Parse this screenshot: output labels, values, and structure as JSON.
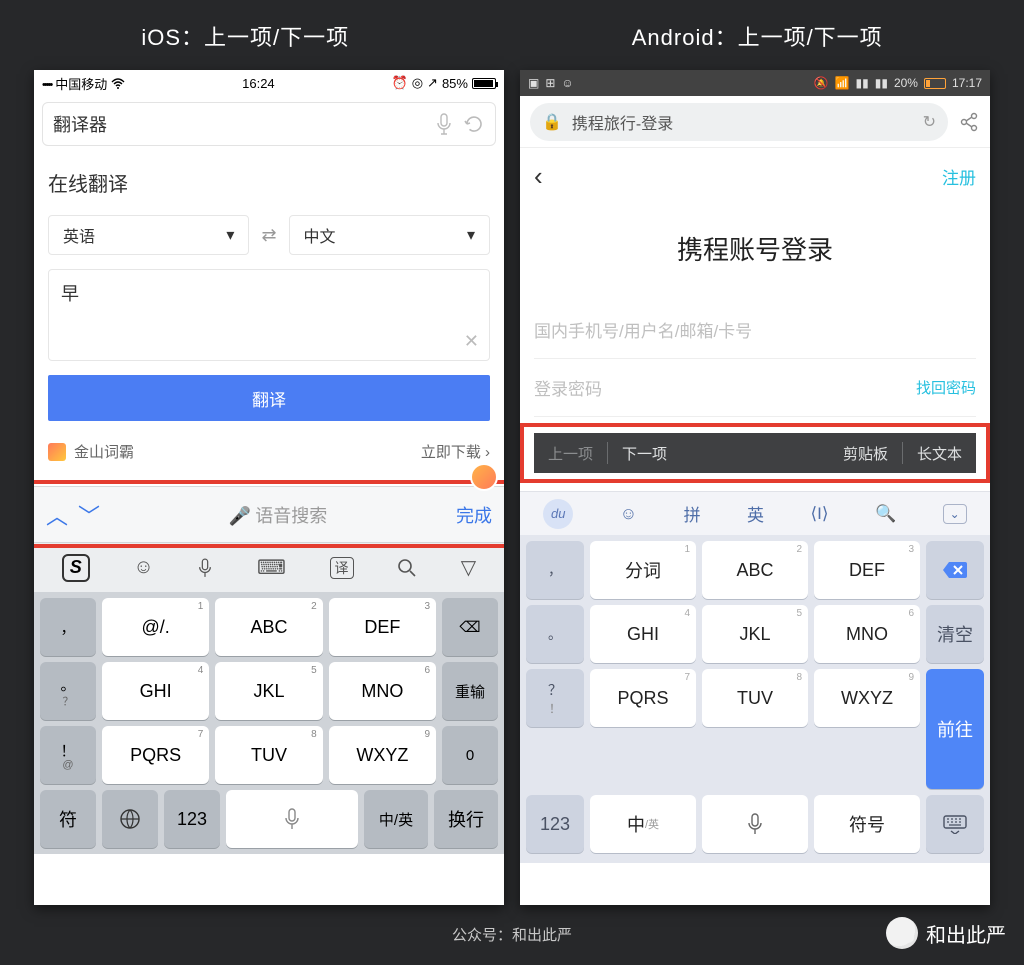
{
  "titles": {
    "ios": "iOS：上一项/下一项",
    "android": "Android：上一项/下一项"
  },
  "ios": {
    "status": {
      "carrier": "中国移动",
      "time": "16:24",
      "battery": "85%"
    },
    "search": {
      "value": "翻译器"
    },
    "card": {
      "title": "在线翻译",
      "source": "英语",
      "target": "中文",
      "text": "早",
      "button": "翻译",
      "dict": "金山词霸",
      "download": "立即下载"
    },
    "accessory": {
      "voice": "语音搜索",
      "done": "完成"
    },
    "cand_logo": "S",
    "kb": {
      "r1": [
        "@/.",
        "ABC",
        "DEF"
      ],
      "r2": [
        "GHI",
        "JKL",
        "MNO"
      ],
      "r3": [
        "PQRS",
        "TUV",
        "WXYZ"
      ],
      "left": [
        "，",
        "。",
        "？",
        "！"
      ],
      "right_del": "⌫",
      "right_reinput": "重输",
      "right_zero": "0",
      "bottom": {
        "sym": "符",
        "num": "123",
        "space_sub": "中/英",
        "enter": "换行"
      }
    }
  },
  "android": {
    "status": {
      "battery": "20%",
      "time": "17:17"
    },
    "url": "携程旅行-登录",
    "app": {
      "register": "注册",
      "title": "携程账号登录",
      "field_user": "国内手机号/用户名/邮箱/卡号",
      "field_pwd": "登录密码",
      "find_pwd": "找回密码"
    },
    "accessory": {
      "prev": "上一项",
      "next": "下一项",
      "clipboard": "剪贴板",
      "longtext": "长文本"
    },
    "tool": {
      "du": "du",
      "pin": "拼",
      "eng": "英"
    },
    "kb": {
      "r1": [
        "分词",
        "ABC",
        "DEF"
      ],
      "r2": [
        "GHI",
        "JKL",
        "MNO"
      ],
      "r3": [
        "PQRS",
        "TUV",
        "WXYZ"
      ],
      "left": [
        "，",
        "。",
        "？",
        "！"
      ],
      "right_del": "⌫",
      "right_clear": "清空",
      "right_go": "前往",
      "bottom": {
        "num": "123",
        "cn": "中",
        "cn_sub": "/英",
        "sym": "符号"
      }
    }
  },
  "footer": {
    "label": "公众号：和出此严",
    "brand": "和出此严"
  }
}
